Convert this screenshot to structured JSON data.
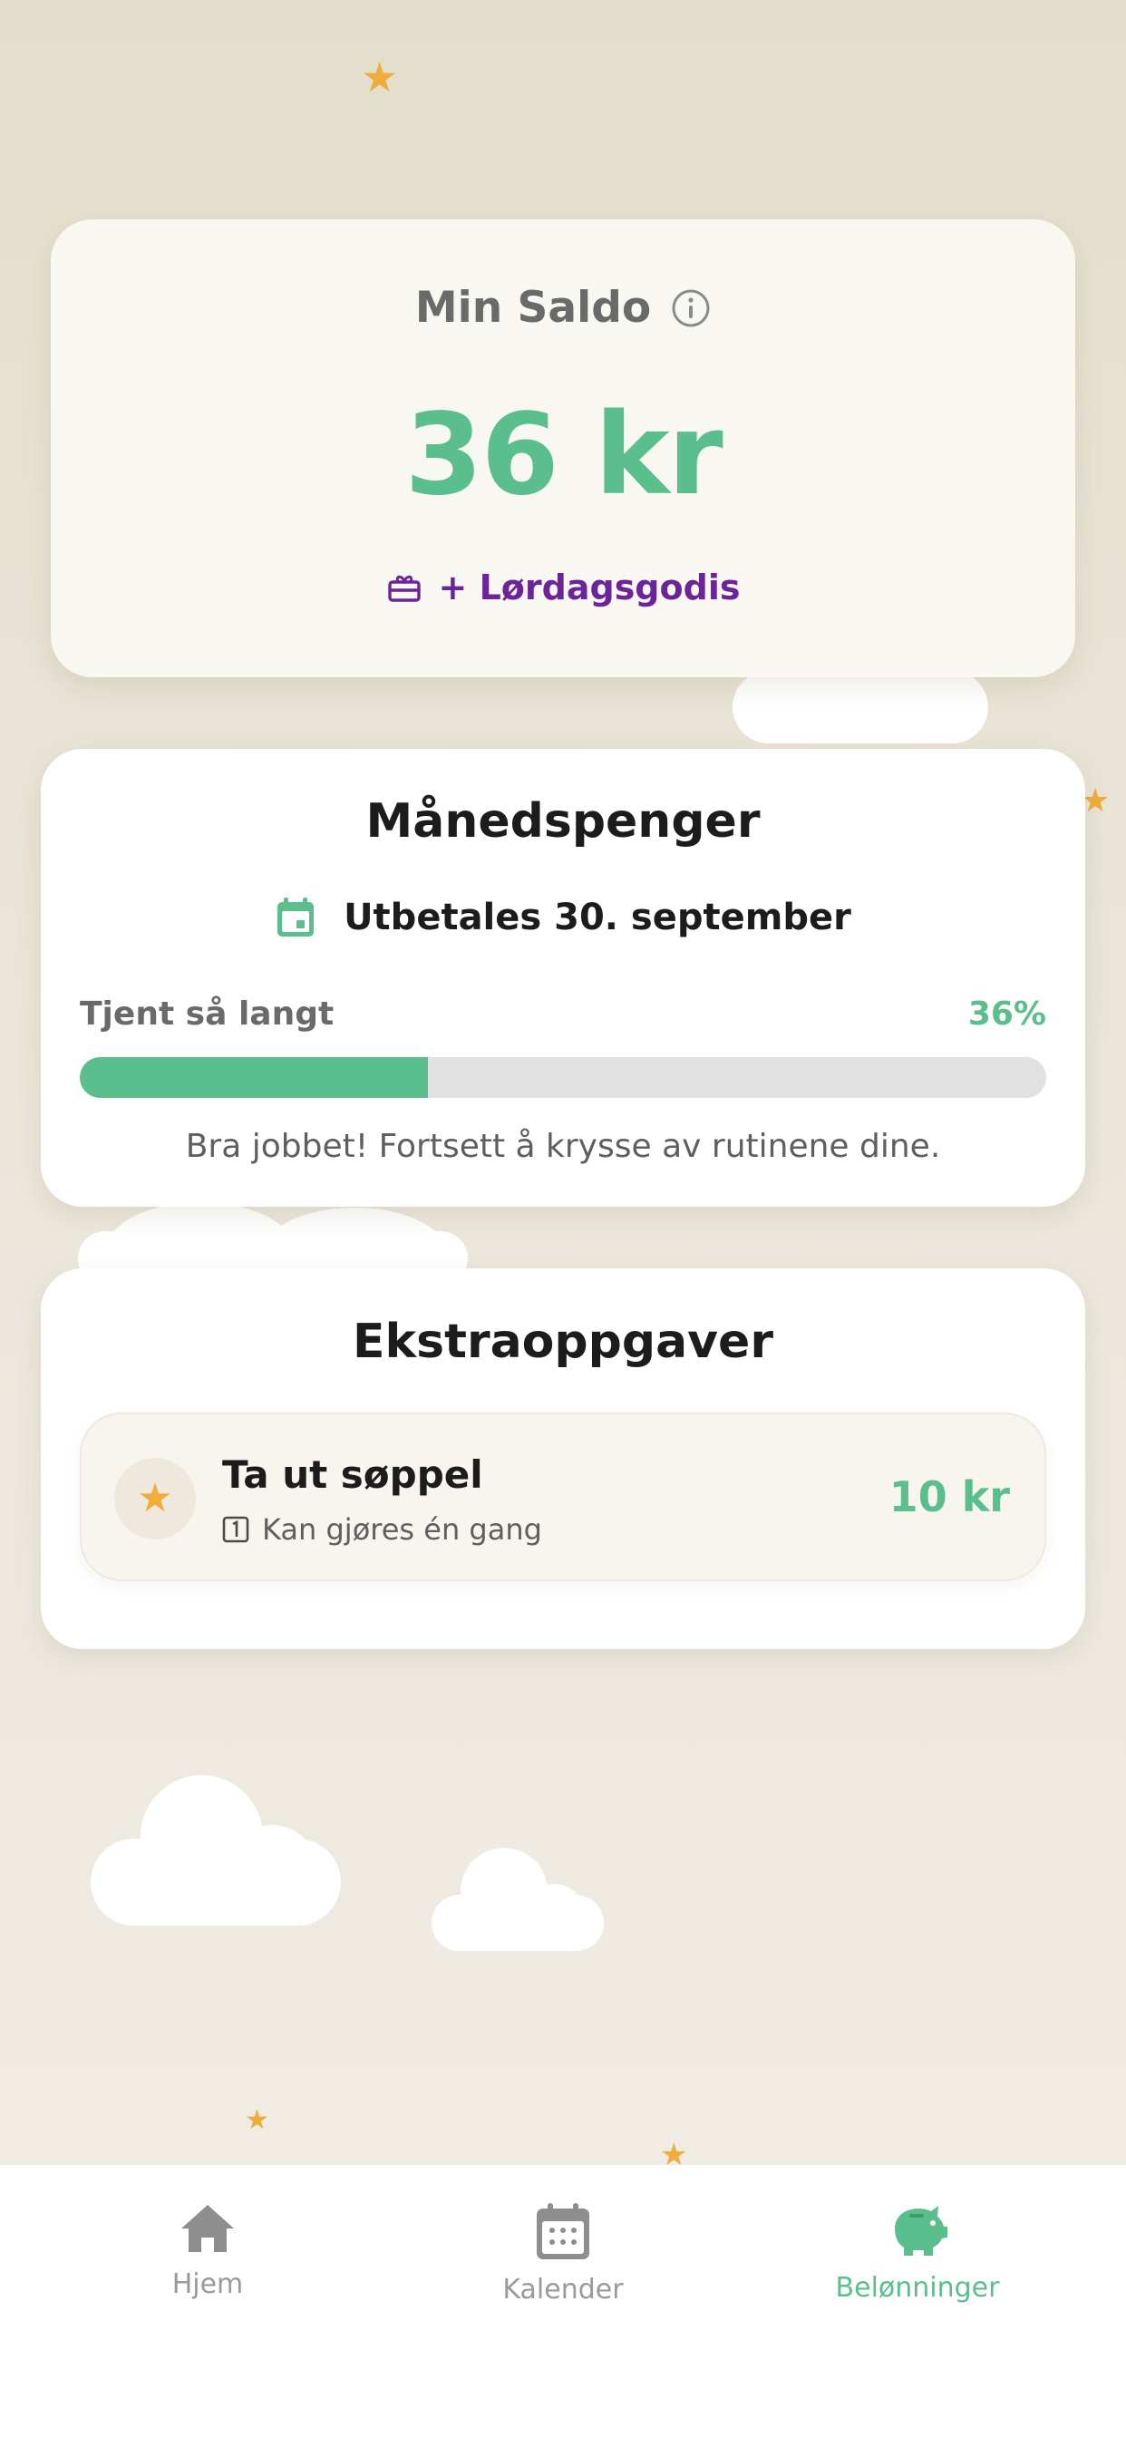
{
  "balance": {
    "title": "Min Saldo",
    "amount": "36 kr",
    "bonus": "+ Lørdagsgodis"
  },
  "allowance": {
    "title": "Månedspenger",
    "payout_date": "Utbetales 30. september",
    "earned_label": "Tjent så langt",
    "earned_percent_text": "36%",
    "progress": 0.36,
    "encouragement": "Bra jobbet! Fortsett å krysse av rutinene dine."
  },
  "extra_tasks": {
    "title": "Ekstraoppgaver",
    "items": [
      {
        "title": "Ta ut søppel",
        "subtitle": "Kan gjøres én gang",
        "reward": "10 kr",
        "icon": "star-icon"
      }
    ]
  },
  "tabbar": {
    "tabs": [
      {
        "label": "Hjem",
        "icon": "home-icon",
        "active": false
      },
      {
        "label": "Kalender",
        "icon": "calendar-icon",
        "active": false
      },
      {
        "label": "Belønninger",
        "icon": "piggy-bank-icon",
        "active": true
      }
    ]
  },
  "colors": {
    "accent_green": "#5bbf8d",
    "bonus_purple": "#6b2499",
    "star_orange": "#f0ad3c"
  }
}
